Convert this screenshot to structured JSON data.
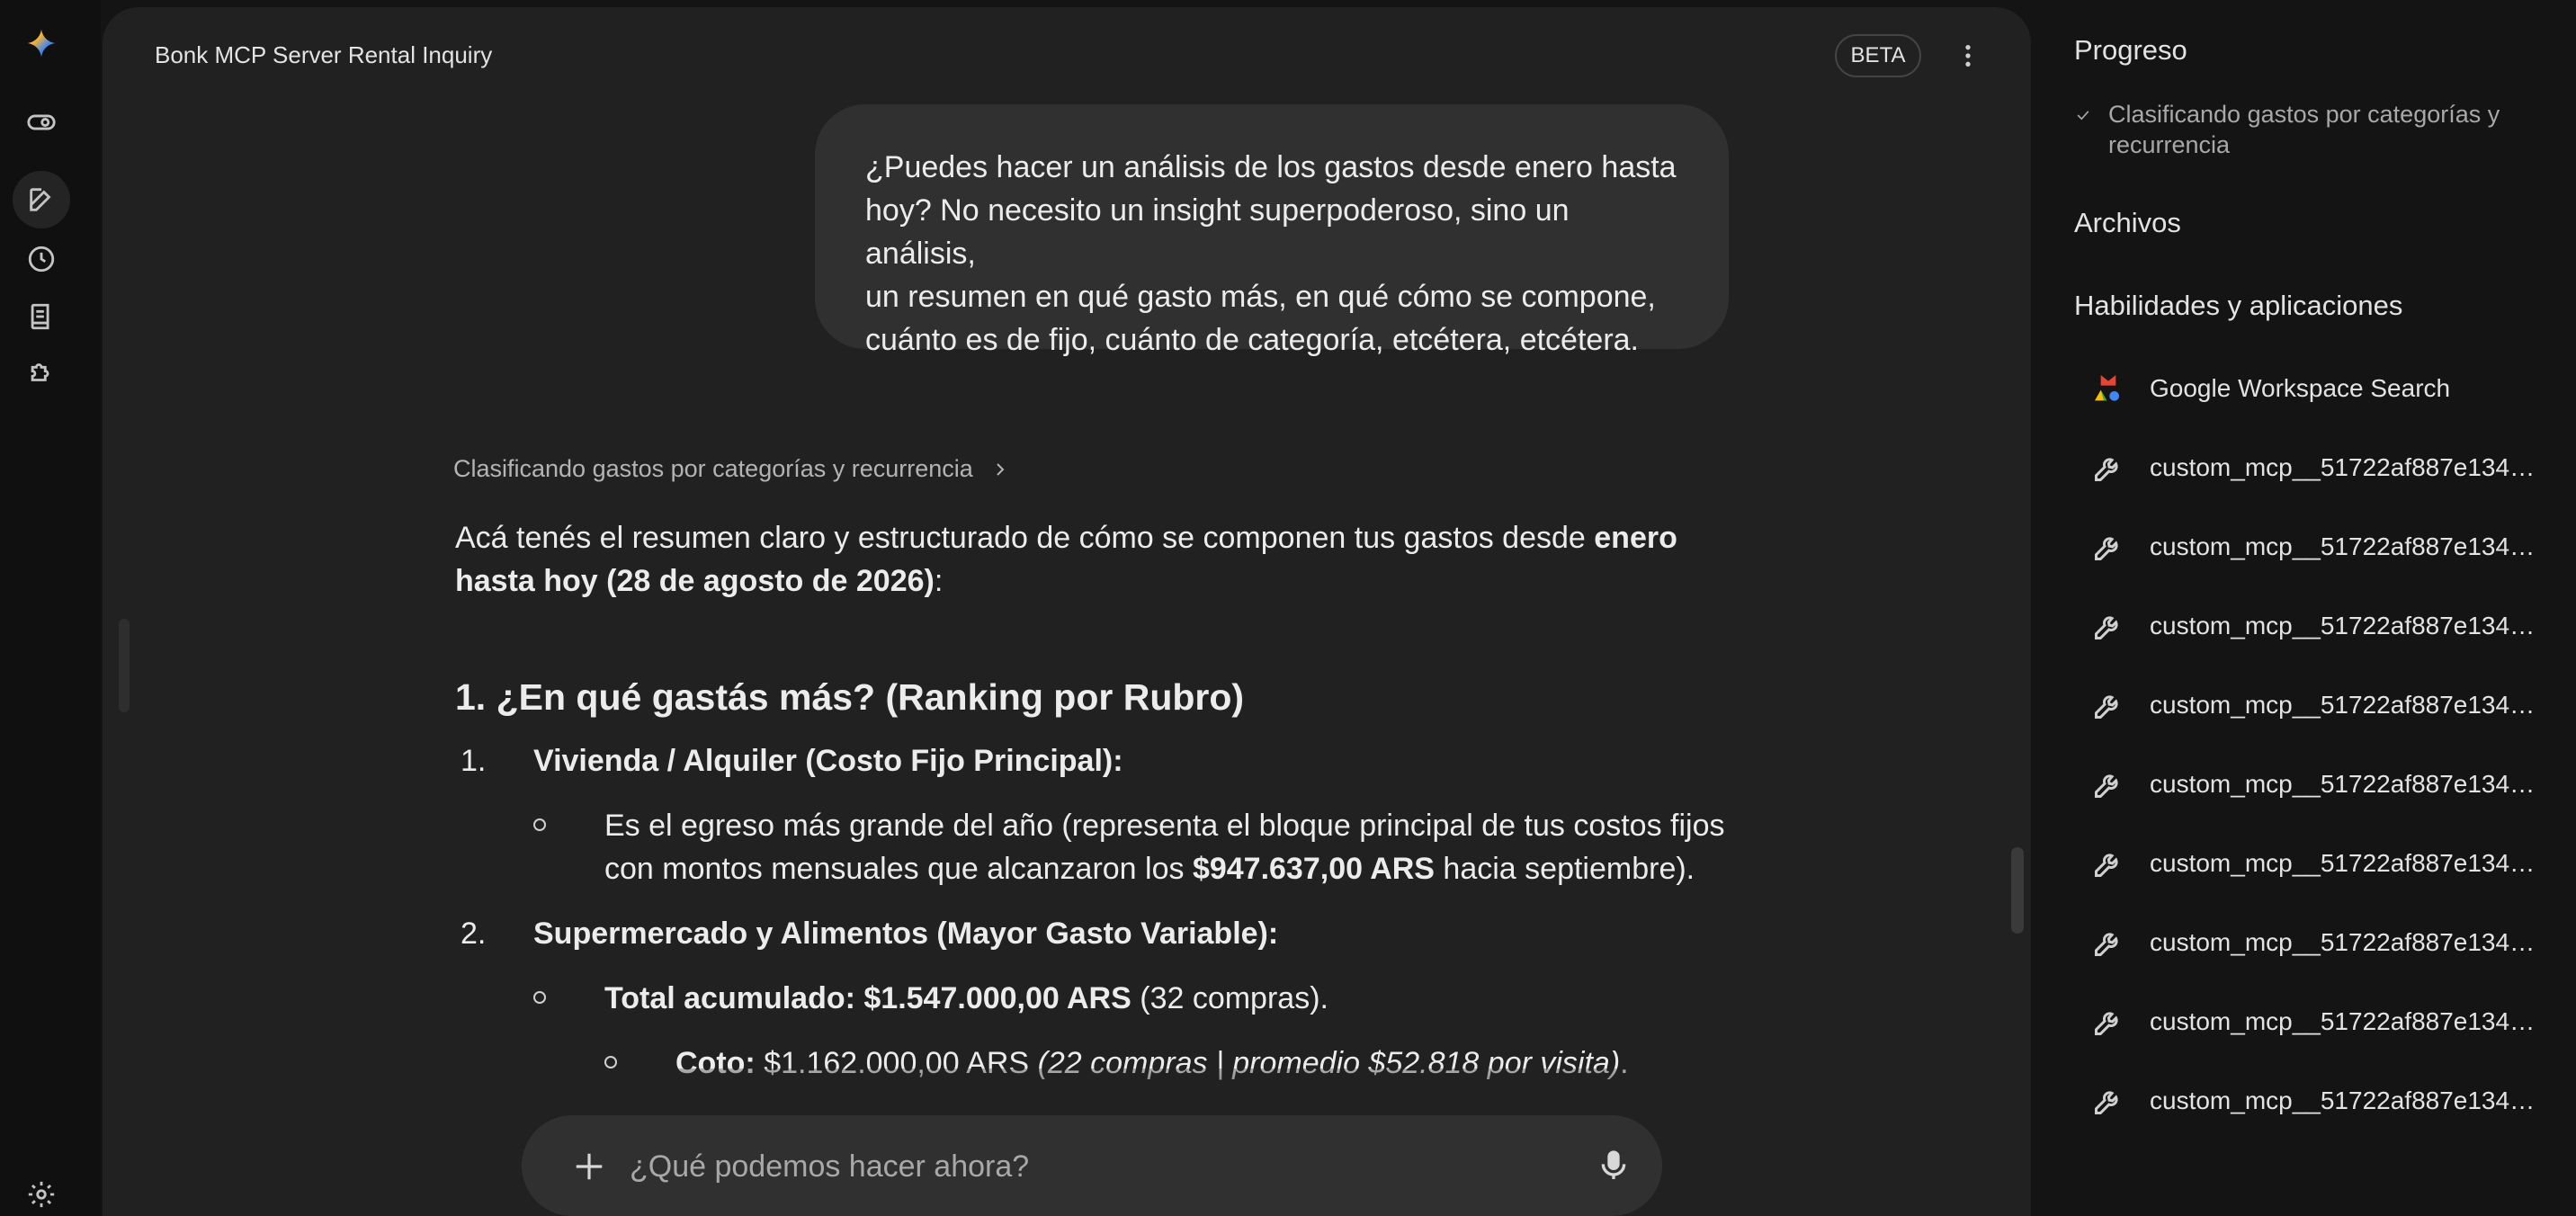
{
  "rail": {
    "items": [
      "gemini-logo",
      "toggle",
      "new-chat",
      "history",
      "notebook",
      "extensions",
      "settings"
    ]
  },
  "header": {
    "title": "Bonk MCP Server Rental Inquiry",
    "badge": "BETA"
  },
  "conversation": {
    "user_message_lines": [
      "¿Puedes hacer un análisis de los gastos desde enero hasta",
      "hoy? No necesito un insight superpoderoso, sino un análisis,",
      "un resumen en qué gasto más, en qué cómo se compone,",
      "cuánto es de fijo, cuánto de categoría, etcétera, etcétera."
    ],
    "thinking_label": "Clasificando gastos por categorías y recurrencia",
    "intro_1": "Acá tenés el resumen claro y estructurado de cómo se componen tus gastos desde ",
    "intro_bold_1": "enero",
    "intro_bold_2": "hasta hoy (28 de agosto de 2026)",
    "intro_end": ":",
    "heading": "1. ¿En qué gastás más? (Ranking por Rubro)",
    "item1_num": "1.",
    "item1_title": "Vivienda / Alquiler (Costo Fijo Principal):",
    "item1_sub_line1": "Es el egreso más grande del año (representa el bloque principal de tus costos fijos",
    "item1_sub_line2_a": "con montos mensuales que alcanzaron los ",
    "item1_sub_line2_b": "$947.637,00 ARS",
    "item1_sub_line2_c": " hacia septiembre).",
    "item2_num": "2.",
    "item2_title": "Supermercado y Alimentos (Mayor Gasto Variable):",
    "item2_sub_bold": "Total acumulado: $1.547.000,00 ARS",
    "item2_sub_rest": " (32 compras).",
    "item2_subsub_bold": "Coto:",
    "item2_subsub_rest": " $1.162.000,00 ARS ",
    "item2_subsub_italic": "(22 compras | promedio $52.818 por visita)",
    "item2_subsub_end": "."
  },
  "composer": {
    "placeholder": "¿Qué podemos hacer ahora?"
  },
  "side": {
    "progress_title": "Progreso",
    "progress_items": [
      "Clasificando gastos por categorías y recurrencia"
    ],
    "files_title": "Archivos",
    "skills_title": "Habilidades y aplicaciones",
    "skills": [
      "Google Workspace Search",
      "custom_mcp__51722af887e1345c0...",
      "custom_mcp__51722af887e1345c0...",
      "custom_mcp__51722af887e1345c0...",
      "custom_mcp__51722af887e1345c0...",
      "custom_mcp__51722af887e1345c0...",
      "custom_mcp__51722af887e1345c0...",
      "custom_mcp__51722af887e1345c0...",
      "custom_mcp__51722af887e1345c0...",
      "custom_mcp__51722af887e1345c0..."
    ]
  },
  "colors": {
    "background": "#141414",
    "panel": "#212121",
    "bubble": "#303030",
    "text": "#e3e3e3",
    "muted": "#a8a8a8"
  }
}
